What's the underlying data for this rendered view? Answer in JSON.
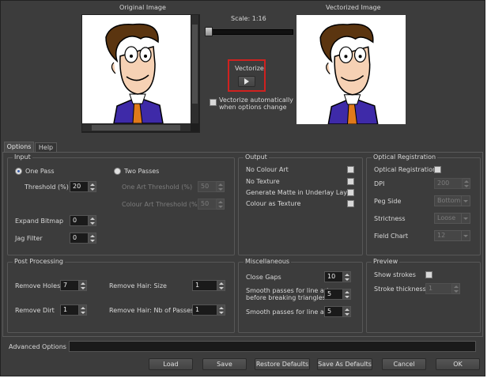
{
  "preview": {
    "original_title": "Original Image",
    "vectorized_title": "Vectorized Image",
    "scale_label": "Scale: 1:16",
    "vectorize_label": "Vectorize",
    "auto_vectorize_label": "Vectorize automatically\nwhen options change"
  },
  "tabs": [
    {
      "label": "Options"
    },
    {
      "label": "Help"
    }
  ],
  "input": {
    "title": "Input",
    "one_pass": "One Pass",
    "two_passes": "Two Passes",
    "threshold_label": "Threshold (%)",
    "threshold_value": "20",
    "one_art_label": "One Art Threshold (%)",
    "one_art_value": "50",
    "colour_art_label": "Colour Art Threshold (%)",
    "colour_art_value": "50",
    "expand_bitmap_label": "Expand Bitmap",
    "expand_bitmap_value": "0",
    "jag_filter_label": "Jag Filter",
    "jag_filter_value": "0"
  },
  "output": {
    "title": "Output",
    "no_colour_art": "No Colour Art",
    "no_texture": "No Texture",
    "generate_matte": "Generate Matte in Underlay Layer",
    "colour_as_texture": "Colour as Texture"
  },
  "optical": {
    "title": "Optical Registration",
    "optical_registration": "Optical Registration",
    "dpi_label": "DPI",
    "dpi_value": "200",
    "peg_side_label": "Peg Side",
    "peg_side_value": "Bottom",
    "strictness_label": "Strictness",
    "strictness_value": "Loose",
    "field_chart_label": "Field Chart",
    "field_chart_value": "12"
  },
  "post": {
    "title": "Post Processing",
    "remove_holes_label": "Remove Holes",
    "remove_holes_value": "7",
    "remove_dirt_label": "Remove Dirt",
    "remove_dirt_value": "1",
    "hair_size_label": "Remove Hair: Size",
    "hair_size_value": "1",
    "hair_passes_label": "Remove Hair: Nb of Passes",
    "hair_passes_value": "1"
  },
  "misc": {
    "title": "Miscellaneous",
    "close_gaps_label": "Close Gaps",
    "close_gaps_value": "10",
    "smooth_before_label": "Smooth passes for line art\nbefore breaking triangles",
    "smooth_before_value": "5",
    "smooth_line_label": "Smooth passes for line art",
    "smooth_line_value": "5"
  },
  "previewgrp": {
    "title": "Preview",
    "show_strokes": "Show strokes",
    "stroke_thickness_label": "Stroke thickness",
    "stroke_thickness_value": "1"
  },
  "advanced_label": "Advanced Options",
  "buttons": {
    "load": "Load",
    "save": "Save",
    "restore": "Restore Defaults",
    "save_as": "Save As Defaults",
    "cancel": "Cancel",
    "ok": "OK"
  },
  "colors": {
    "highlight": "#d0211f",
    "background": "#3c3c3c",
    "radio_dot": "#3b5ea8"
  }
}
